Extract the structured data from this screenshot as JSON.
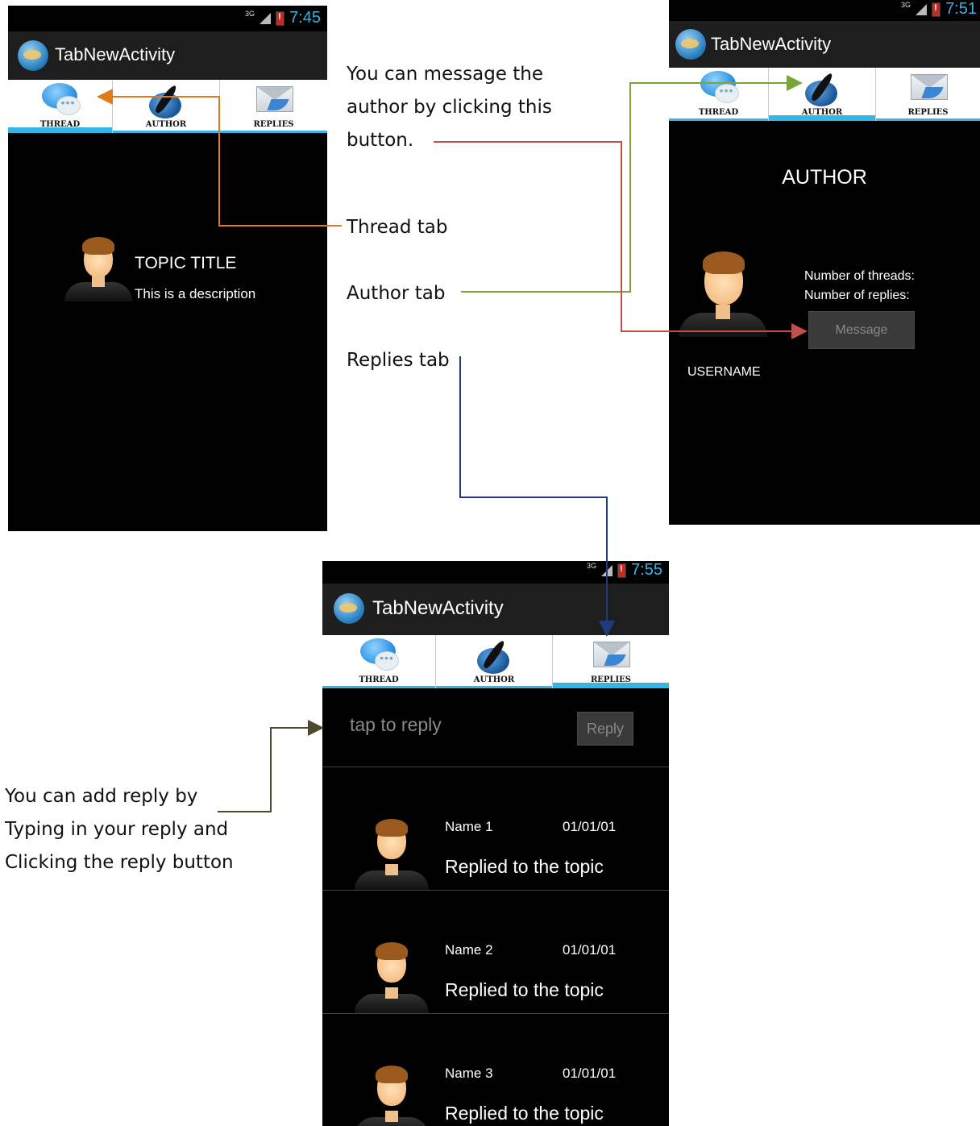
{
  "annotations": {
    "message_line1": "You can message the",
    "message_line2": "author by clicking this",
    "message_line3": "button.",
    "thread_tab": "Thread tab",
    "author_tab": "Author tab",
    "replies_tab": "Replies tab",
    "reply_line1": "You can add reply by",
    "reply_line2": "Typing in your reply and",
    "reply_line3": "Clicking the reply button"
  },
  "colors": {
    "orange_arrow": "#e07a1a",
    "green_arrow": "#7aa33a",
    "red_arrow": "#c0504d",
    "navy_arrow": "#1f3c78",
    "olive_arrow": "#4e4a2e",
    "accent": "#33b5e5"
  },
  "tabs": {
    "thread": "THREAD",
    "author": "AUTHOR",
    "replies": "REPLIES"
  },
  "screen1": {
    "clock": "7:45",
    "app_title": "TabNewActivity",
    "selected_tab": "thread",
    "topic_title": "TOPIC TITLE",
    "description": "This is a description"
  },
  "screen2": {
    "clock": "7:51",
    "app_title": "TabNewActivity",
    "selected_tab": "author",
    "heading": "AUTHOR",
    "threads_label": "Number of threads:",
    "replies_label": "Number of replies:",
    "message_button": "Message",
    "username": "USERNAME"
  },
  "screen3": {
    "clock": "7:55",
    "app_title": "TabNewActivity",
    "selected_tab": "replies",
    "reply_placeholder": "tap to reply",
    "reply_button": "Reply",
    "replies": [
      {
        "name": "Name 1",
        "date": "01/01/01",
        "text": "Replied to the topic"
      },
      {
        "name": "Name 2",
        "date": "01/01/01",
        "text": "Replied to the topic"
      },
      {
        "name": "Name 3",
        "date": "01/01/01",
        "text": "Replied to the topic"
      }
    ]
  }
}
